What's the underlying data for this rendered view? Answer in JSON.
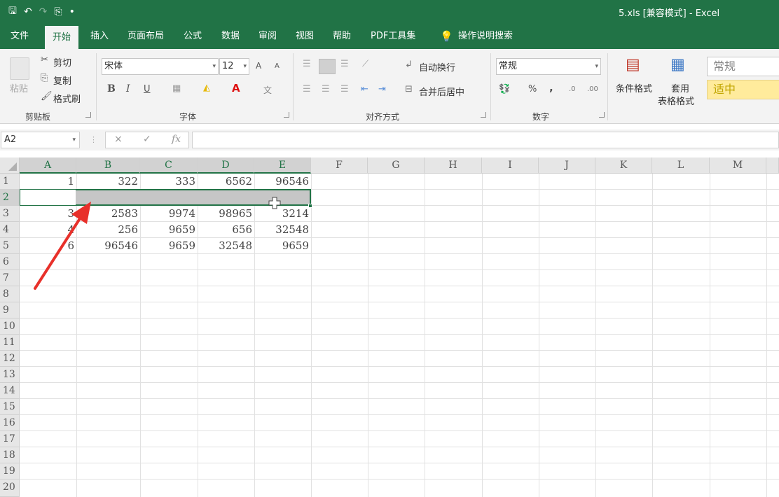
{
  "qat": {
    "save": "🖫",
    "undo": "↶",
    "redo": "↷",
    "preview": "⎘",
    "more": "•"
  },
  "window": {
    "title": "5.xls  [兼容模式]  -  Excel"
  },
  "tabs": [
    {
      "label": "文件"
    },
    {
      "label": "开始"
    },
    {
      "label": "插入"
    },
    {
      "label": "页面布局"
    },
    {
      "label": "公式"
    },
    {
      "label": "数据"
    },
    {
      "label": "审阅"
    },
    {
      "label": "视图"
    },
    {
      "label": "帮助"
    },
    {
      "label": "PDF工具集"
    },
    {
      "label": "操作说明搜索"
    }
  ],
  "clipboard": {
    "paste": "粘贴",
    "cut": "剪切",
    "copy": "复制",
    "format_painter": "格式刷",
    "group": "剪贴板"
  },
  "font": {
    "name": "宋体",
    "size": "12",
    "grow": "A",
    "shrink": "A",
    "bold": "B",
    "italic": "I",
    "underline": "U",
    "color": "A",
    "phonetic": "文",
    "group": "字体"
  },
  "alignment": {
    "wrap": "自动换行",
    "merge": "合并后居中",
    "group": "对齐方式"
  },
  "number": {
    "format": "常规",
    "percent": "%",
    "comma": ",",
    "group": "数字"
  },
  "styles": {
    "conditional": "条件格式",
    "table1": "套用",
    "table2": "表格格式",
    "normal": "常规",
    "neutral": "适中"
  },
  "formula_bar": {
    "name_box": "A2",
    "cancel": "×",
    "enter": "✓",
    "fx": "fx",
    "value": ""
  },
  "columns": [
    "A",
    "B",
    "C",
    "D",
    "E",
    "F",
    "G",
    "H",
    "I",
    "J",
    "K",
    "L",
    "M"
  ],
  "rows": [
    "1",
    "2",
    "3",
    "4",
    "5",
    "6",
    "7",
    "8",
    "9",
    "10",
    "11",
    "12",
    "13",
    "14",
    "15",
    "16",
    "17",
    "18",
    "19",
    "20"
  ],
  "cells": [
    [
      "1",
      "322",
      "333",
      "6562",
      "96546"
    ],
    [
      "",
      "",
      "",
      "",
      ""
    ],
    [
      "3",
      "2583",
      "9974",
      "98965",
      "3214"
    ],
    [
      "4",
      "256",
      "9659",
      "656",
      "32548"
    ],
    [
      "6",
      "96546",
      "9659",
      "32548",
      "9659"
    ]
  ],
  "selection": {
    "active_cell": "A2",
    "range": "A2:E2"
  },
  "colors": {
    "brand": "#217346",
    "selection": "#c6c6c6",
    "arrow": "#e8302a",
    "neutral_style": "#ffeb9c"
  }
}
